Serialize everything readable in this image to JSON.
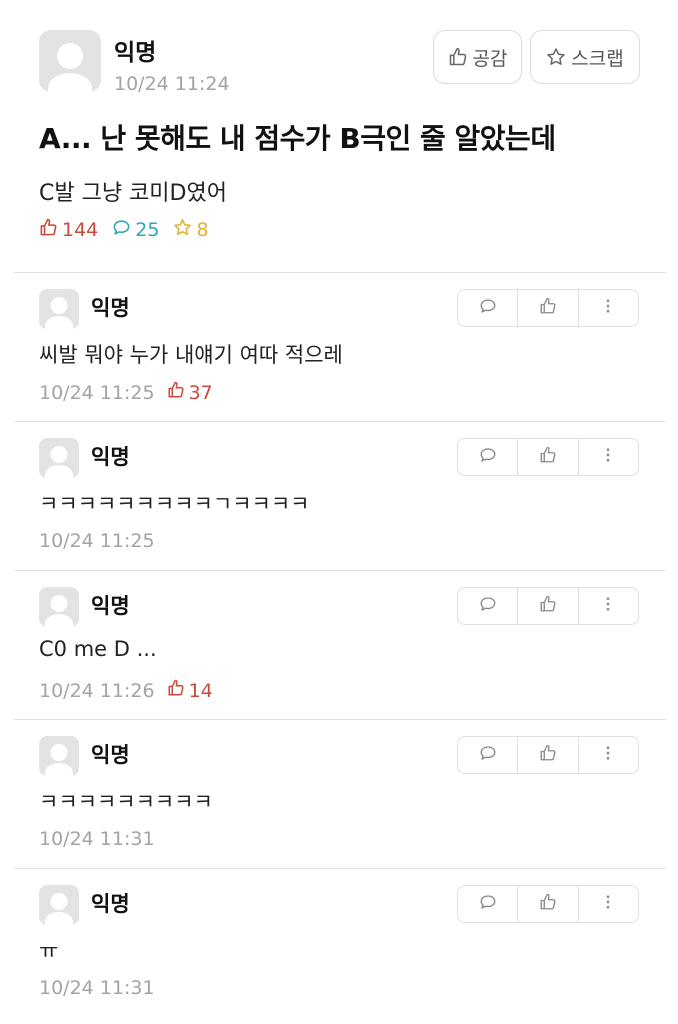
{
  "post": {
    "author": "익명",
    "time": "10/24 11:24",
    "like_button_label": "공감",
    "scrap_button_label": "스크랩",
    "title": "A... 난 못해도 내 점수가 B극인 줄 알았는데",
    "body": "C발 그냥 코미D였어",
    "stats": {
      "likes": "144",
      "comments": "25",
      "scraps": "8"
    }
  },
  "comments": [
    {
      "author": "익명",
      "text": "씨발 뭐야 누가 내얘기 여따 적으레",
      "time": "10/24 11:25",
      "likes": "37"
    },
    {
      "author": "익명",
      "text": "ㅋㅋㅋㅋㅋㅋㅋㅋㅋㄱㅋㅋㅋㅋ",
      "time": "10/24 11:25",
      "likes": ""
    },
    {
      "author": "익명",
      "text": "C0 me D ...",
      "time": "10/24 11:26",
      "likes": "14"
    },
    {
      "author": "익명",
      "text": "ㅋㅋㅋㅋㅋㅋㅋㅋㅋ",
      "time": "10/24 11:31",
      "likes": ""
    },
    {
      "author": "익명",
      "text": "ㅠ",
      "time": "10/24 11:31",
      "likes": ""
    }
  ],
  "colors": {
    "like": "#c64b3a",
    "comment": "#2fa6b4",
    "scrap": "#e1b12c",
    "muted": "#a3a3a3"
  },
  "icons": [
    "thumbs-up-icon",
    "star-icon",
    "speech-bubble-icon",
    "more-vertical-icon"
  ]
}
